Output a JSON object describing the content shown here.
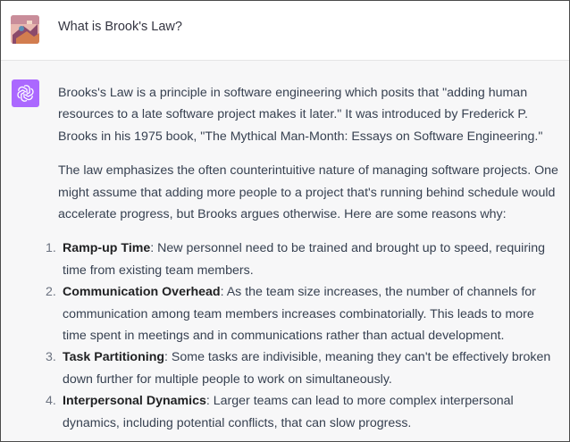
{
  "user_message": {
    "text": "What is Brook's Law?"
  },
  "assistant_message": {
    "paragraphs": [
      "Brooks's Law is a principle in software engineering which posits that \"adding human resources to a late software project makes it later.\" It was introduced by Frederick P. Brooks in his 1975 book, \"The Mythical Man-Month: Essays on Software Engineering.\"",
      "The law emphasizes the often counterintuitive nature of managing software projects. One might assume that adding more people to a project that's running behind schedule would accelerate progress, but Brooks argues otherwise. Here are some reasons why:"
    ],
    "list": [
      {
        "num": "1.",
        "title": "Ramp-up Time",
        "text": ": New personnel need to be trained and brought up to speed, requiring time from existing team members."
      },
      {
        "num": "2.",
        "title": "Communication Overhead",
        "text": ": As the team size increases, the number of channels for communication among team members increases combinatorially. This leads to more time spent in meetings and in communications rather than actual development."
      },
      {
        "num": "3.",
        "title": "Task Partitioning",
        "text": ": Some tasks are indivisible, meaning they can't be effectively broken down further for multiple people to work on simultaneously."
      },
      {
        "num": "4.",
        "title": "Interpersonal Dynamics",
        "text": ": Larger teams can lead to more complex interpersonal dynamics, including potential conflicts, that can slow progress."
      }
    ]
  },
  "icons": {
    "user_avatar": "user-avatar-icon",
    "assistant_avatar": "openai-logo-icon"
  },
  "colors": {
    "assistant_avatar_bg": "#ab68ff",
    "assistant_row_bg": "#f7f7f8",
    "text": "#374151"
  }
}
